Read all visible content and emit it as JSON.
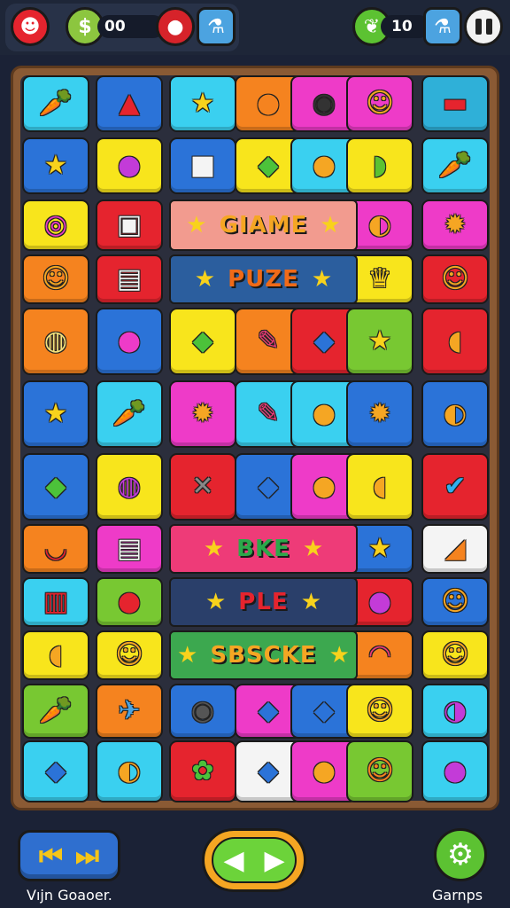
{
  "hud": {
    "coins": "00",
    "moves": "10"
  },
  "bands": [
    {
      "word": "GIAME",
      "color": "#f5a623",
      "bg": "#f29b8f"
    },
    {
      "word": "PUZE",
      "color": "#f06a18",
      "bg": "#2b5e9e"
    },
    {
      "word": "BKE",
      "color": "#2ca94a",
      "bg": "#ee3b78"
    },
    {
      "word": "PLE",
      "color": "#e5242e",
      "bg": "#2a3f6a"
    },
    {
      "word": "SBSCKE",
      "color": "#f5a623",
      "bg": "#3ca84f"
    }
  ],
  "bottom": {
    "left_label": "Vıjn Goaoer.",
    "right_label": "Garnps"
  },
  "colors": {
    "cyan": "#3ad0f0",
    "blue": "#2b73d8",
    "red": "#e5242e",
    "orange": "#f5831f",
    "pink": "#ee3bc8",
    "yellow": "#f8e51c",
    "green": "#78c832",
    "white": "#f4f4f4",
    "teal": "#2fb0d8"
  }
}
